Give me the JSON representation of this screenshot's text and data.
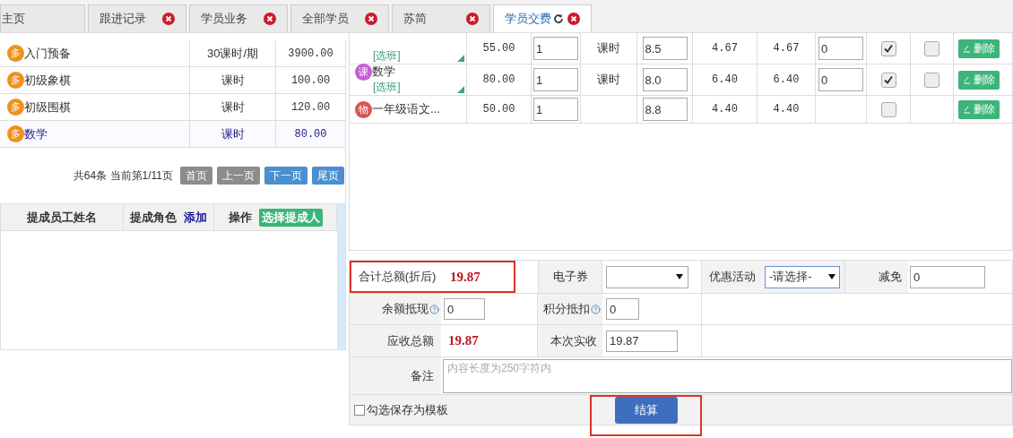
{
  "tabs": [
    {
      "label": "主页",
      "selected": false,
      "closable": false,
      "refresh": false
    },
    {
      "label": "跟进记录",
      "selected": false,
      "closable": true,
      "refresh": false
    },
    {
      "label": "学员业务",
      "selected": false,
      "closable": true,
      "refresh": false
    },
    {
      "label": "全部学员",
      "selected": false,
      "closable": true,
      "refresh": false
    },
    {
      "label": "苏简",
      "selected": false,
      "closable": true,
      "refresh": false
    },
    {
      "label": "学员交费",
      "selected": true,
      "closable": true,
      "refresh": true
    }
  ],
  "course_list": {
    "rows": [
      {
        "badge": "多",
        "name": "入门预备",
        "unit": "30课时/期",
        "price": "3900.00",
        "selected": false
      },
      {
        "badge": "多",
        "name": "初级象棋",
        "unit": "课时",
        "price": "100.00",
        "selected": false
      },
      {
        "badge": "多",
        "name": "初级围棋",
        "unit": "课时",
        "price": "120.00",
        "selected": false
      },
      {
        "badge": "多",
        "name": "数学",
        "unit": "课时",
        "price": "80.00",
        "selected": true
      }
    ],
    "pager": {
      "info": "共64条 当前第1/11页",
      "buttons": [
        {
          "label": "首页",
          "enabled": false
        },
        {
          "label": "上一页",
          "enabled": false
        },
        {
          "label": "下一页",
          "enabled": true
        },
        {
          "label": "尾页",
          "enabled": true
        }
      ]
    }
  },
  "commission": {
    "columns": [
      {
        "label": "提成员工姓名"
      },
      {
        "label": "提成角色",
        "link": "添加"
      },
      {
        "label": "操作",
        "button": "选择提成人"
      }
    ]
  },
  "cart": {
    "rows": [
      {
        "badge": null,
        "name": null,
        "class_link": "[选班]",
        "price": "55.00",
        "qty": "1",
        "unit": "课时",
        "discount": "8.5",
        "col_6": "4.67",
        "col_7": "4.67",
        "col_8": "0",
        "checked_1": true,
        "checked_2": false,
        "delete": "删除"
      },
      {
        "badge": "课",
        "color": "#c55fd6",
        "name": "数学",
        "class_link": "[选班]",
        "price": "80.00",
        "qty": "1",
        "unit": "课时",
        "discount": "8.0",
        "col_6": "6.40",
        "col_7": "6.40",
        "col_8": "0",
        "checked_1": true,
        "checked_2": false,
        "delete": "删除"
      },
      {
        "badge": "物",
        "color": "#d9534f",
        "name": "一年级语文...",
        "class_link": null,
        "price": "50.00",
        "qty": "1",
        "unit": null,
        "discount": "8.8",
        "col_6": "4.40",
        "col_7": "4.40",
        "col_8": null,
        "checked_1": false,
        "checked_2": null,
        "delete": "删除"
      }
    ]
  },
  "payment": {
    "total_label": "合计总额(折后)",
    "total": "19.87",
    "total_highlighted": true,
    "coupon_label": "电子券",
    "promo_label": "优惠活动",
    "promo_value": "-请选择-",
    "reduce_label": "减免",
    "reduce_value": "0",
    "balance_label": "余额抵现",
    "balance_value": "0",
    "points_label": "积分抵扣",
    "points_value": "0",
    "due_label": "应收总额",
    "due": "19.87",
    "paid_label": "本次实收",
    "paid_value": "19.87",
    "note_label": "备注",
    "note_placeholder": "内容长度为250字符内",
    "template_label": "勾选保存为模板",
    "template_checked": false,
    "submit": "结算",
    "submit_highlighted": true
  }
}
